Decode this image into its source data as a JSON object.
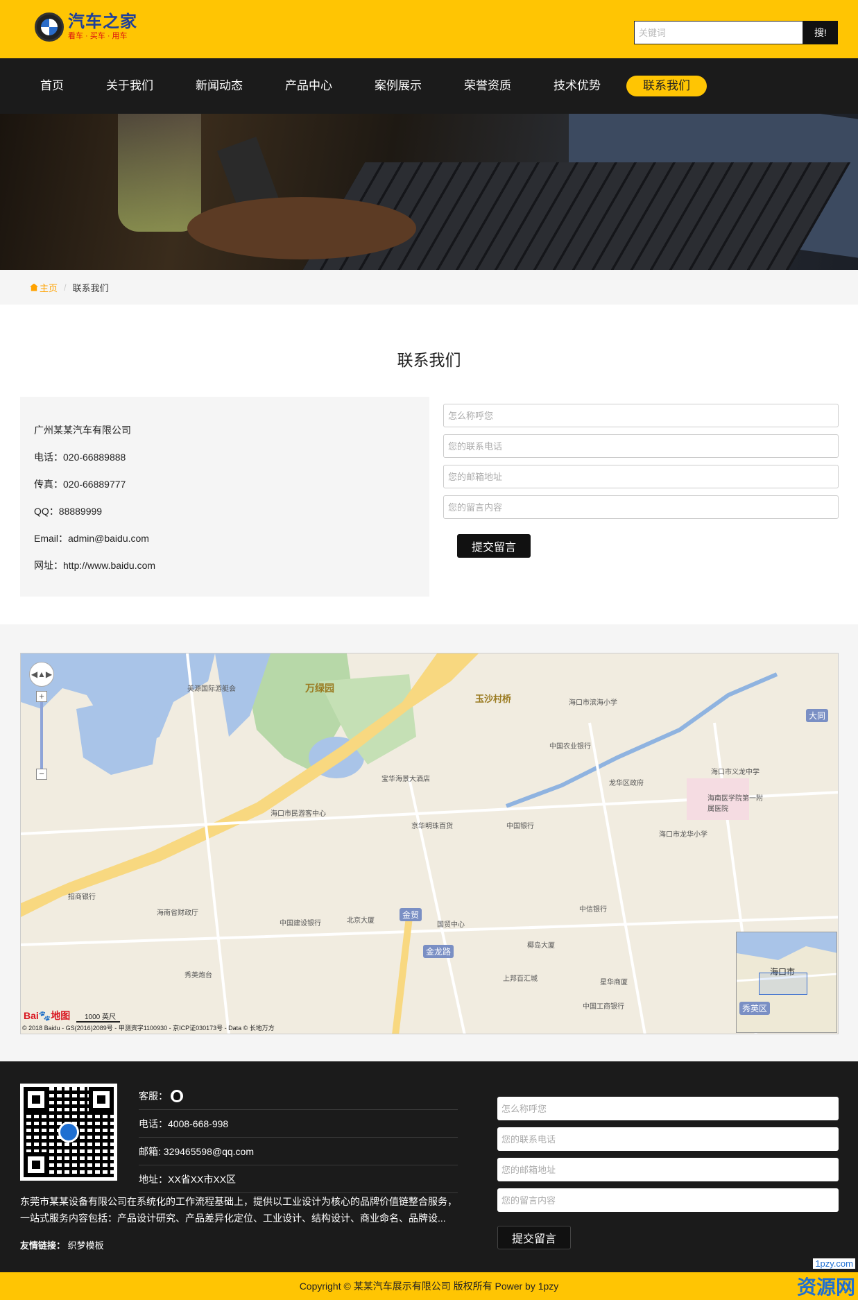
{
  "header": {
    "logo_title": "汽车之家",
    "logo_sub": "看车 · 买车 · 用车",
    "search_placeholder": "关键词",
    "search_button": "搜!"
  },
  "nav": {
    "items": [
      {
        "label": "首页"
      },
      {
        "label": "关于我们"
      },
      {
        "label": "新闻动态"
      },
      {
        "label": "产品中心"
      },
      {
        "label": "案例展示"
      },
      {
        "label": "荣誉资质"
      },
      {
        "label": "技术优势"
      },
      {
        "label": "联系我们",
        "active": true
      }
    ]
  },
  "breadcrumb": {
    "home": "主页",
    "separator": "/",
    "current": "联系我们"
  },
  "contact": {
    "title": "联系我们",
    "company": "广州某某汽车有限公司",
    "phone": "电话：020-66889888",
    "fax": "传真：020-66889777",
    "qq": "QQ：88889999",
    "email": "Email：admin@baidu.com",
    "website": "网址：http://www.baidu.com"
  },
  "form": {
    "name_placeholder": "怎么称呼您",
    "phone_placeholder": "您的联系电话",
    "email_placeholder": "您的邮箱地址",
    "message_placeholder": "您的留言内容",
    "submit": "提交留言"
  },
  "map": {
    "labels": {
      "l1": "万绿园",
      "l2": "玉沙村桥",
      "l3": "海口市滨海小学",
      "l4": "中国农业银行",
      "l5": "龙华区政府",
      "l6": "海口市义龙中学",
      "l7": "海南医学院第一附属医院",
      "l8": "京华明珠百货",
      "l9": "中国银行",
      "l10": "海口市龙华小学",
      "l11": "中信银行",
      "l12": "中国建设银行",
      "l13": "北京大厦",
      "l14": "国贸中心",
      "l15": "椰岛大厦",
      "l16": "上邦百汇城",
      "l17": "星华商厦",
      "l18": "中国工商银行",
      "l19": "秀英炮台",
      "l20": "海南省财政厅",
      "l21": "招商银行",
      "l22": "金贸",
      "l23": "金龙路",
      "l24": "大同",
      "l25": "海口市民游客中心",
      "l26": "宝华海景大酒店",
      "l27": "美源国际游艇会"
    },
    "minimap_label": "海口市",
    "minimap_tag": "秀英区",
    "baidu_logo": "Bai🐾地图",
    "scale": "1000 英尺",
    "copyright": "© 2018 Baidu - GS(2016)2089号 - 甲测资字1100930 - 京ICP证030173号 - Data © 长地万方"
  },
  "footer": {
    "service": "客服：",
    "phone": "电话：4008-668-998",
    "email": "邮箱: 329465598@qq.com",
    "address": "地址：XX省XX市XX区",
    "description": "东莞市某某设备有限公司在系统化的工作流程基础上，提供以工业设计为核心的品牌价值链整合服务，一站式服务内容包括：产品设计研究、产品差异化定位、工业设计、结构设计、商业命名、品牌设...",
    "links_label": "友情链接：",
    "links": [
      {
        "label": "织梦模板"
      }
    ]
  },
  "copyright": "Copyright © 某某汽车展示有限公司 版权所有 Power by 1pzy",
  "watermark": {
    "site": "1pzy.com",
    "text": "资源网"
  },
  "colors": {
    "accent": "#ffc503",
    "nav_bg": "#1b1b1b",
    "footer_bg": "#1b1b1b"
  }
}
